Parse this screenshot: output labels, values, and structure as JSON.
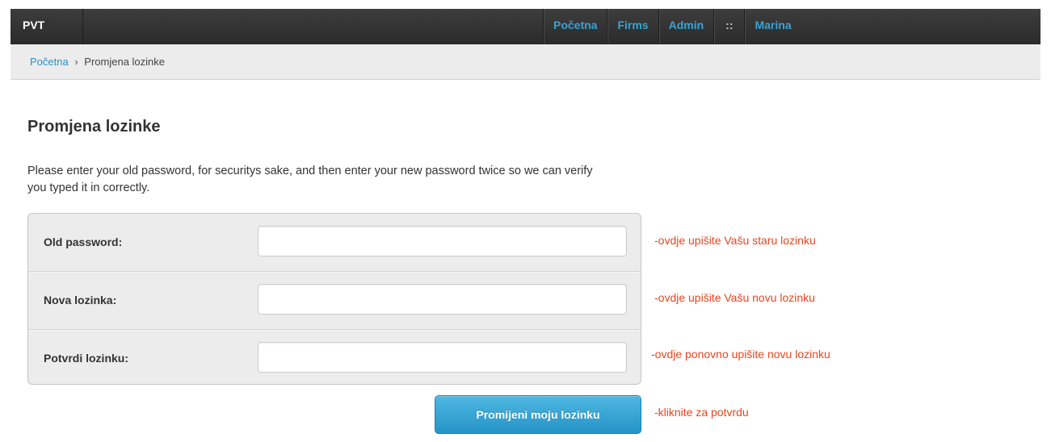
{
  "header": {
    "brand": "PVT",
    "nav": [
      {
        "label": "Početna"
      },
      {
        "label": "Firms"
      },
      {
        "label": "Admin"
      },
      {
        "label": "::"
      },
      {
        "label": "Marina"
      }
    ]
  },
  "breadcrumb": {
    "home": "Početna",
    "separator": "›",
    "current": "Promjena lozinke"
  },
  "main": {
    "title": "Promjena lozinke",
    "intro": "Please enter your old password, for securitys sake, and then enter your new password twice so we can verify you typed it in correctly.",
    "fields": [
      {
        "label": "Old password:",
        "value": "",
        "hint": "-ovdje upišite Vašu staru lozinku"
      },
      {
        "label": "Nova lozinka:",
        "value": "",
        "hint": "-ovdje upišite Vašu novu lozinku"
      },
      {
        "label": "Potvrdi lozinku:",
        "value": "",
        "hint": "-ovdje ponovno upišite novu lozinku"
      }
    ],
    "submit_label": "Promijeni moju lozinku",
    "submit_hint": "-kliknite za potvrdu"
  },
  "colors": {
    "topbar": "#333333",
    "nav_link": "#3aa3d4",
    "hint_text": "#e8451e",
    "button": "#2b9ccf"
  }
}
